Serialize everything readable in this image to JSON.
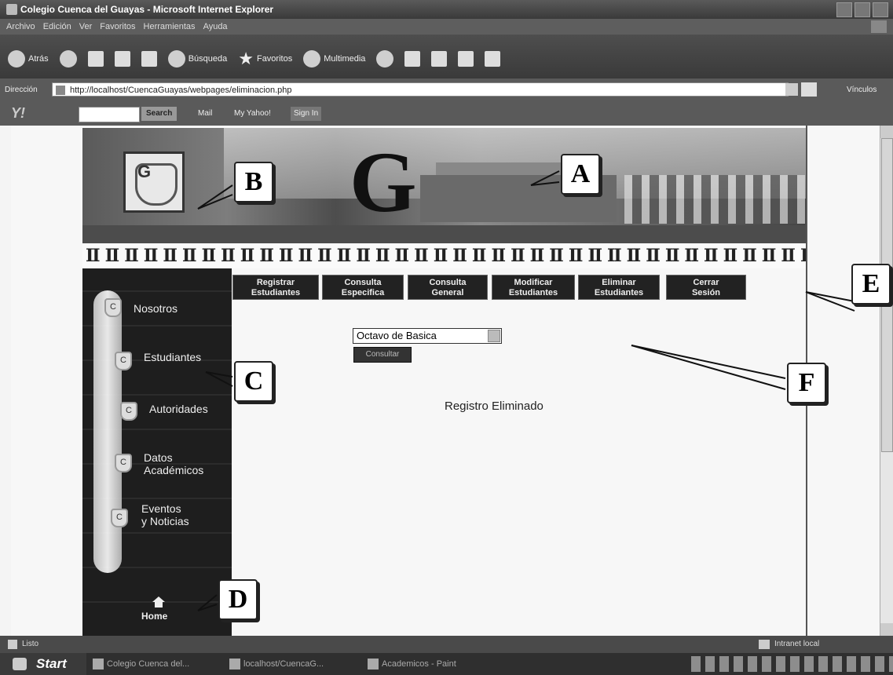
{
  "window": {
    "title": "Colegio Cuenca del Guayas - Microsoft Internet Explorer"
  },
  "menu": [
    "Archivo",
    "Edición",
    "Ver",
    "Favoritos",
    "Herramientas",
    "Ayuda"
  ],
  "toolbar": {
    "back": "Atrás",
    "search": "Búsqueda",
    "favorites": "Favoritos",
    "multimedia": "Multimedia"
  },
  "address": {
    "label": "Dirección",
    "url": "http://localhost/CuencaGuayas/webpages/eliminacion.php",
    "links": "Vínculos"
  },
  "yahoo": {
    "logo": "Y!",
    "search": "Search",
    "mail": "Mail",
    "my_yahoo": "My Yahoo!",
    "sign_in": "Sign In"
  },
  "page": {
    "banner_letter": "G",
    "top_buttons": [
      {
        "line1": "Registrar",
        "line2": "Estudiantes"
      },
      {
        "line1": "Consulta",
        "line2": "Especifica"
      },
      {
        "line1": "Consulta",
        "line2": "General"
      },
      {
        "line1": "Modificar",
        "line2": "Estudiantes"
      },
      {
        "line1": "Eliminar",
        "line2": "Estudiantes"
      },
      {
        "line1": "Cerrar",
        "line2": "Sesión"
      }
    ],
    "left_nav": [
      {
        "line1": "Nosotros",
        "line2": ""
      },
      {
        "line1": "Estudiantes",
        "line2": ""
      },
      {
        "line1": "Autoridades",
        "line2": ""
      },
      {
        "line1": "Datos",
        "line2": "Académicos"
      },
      {
        "line1": "Eventos",
        "line2": "y Noticias"
      }
    ],
    "home": "Home",
    "select_value": "Octavo de Basica",
    "consultar": "Consultar",
    "message": "Registro Eliminado"
  },
  "callouts": {
    "a": "A",
    "b": "B",
    "c": "C",
    "d": "D",
    "e": "E",
    "f": "F"
  },
  "status": {
    "left": "Listo",
    "right": "Intranet local"
  },
  "taskbar": {
    "start": "Start",
    "tasks": [
      "Colegio Cuenca del...",
      "localhost/CuencaG...",
      "Academicos - Paint"
    ]
  }
}
